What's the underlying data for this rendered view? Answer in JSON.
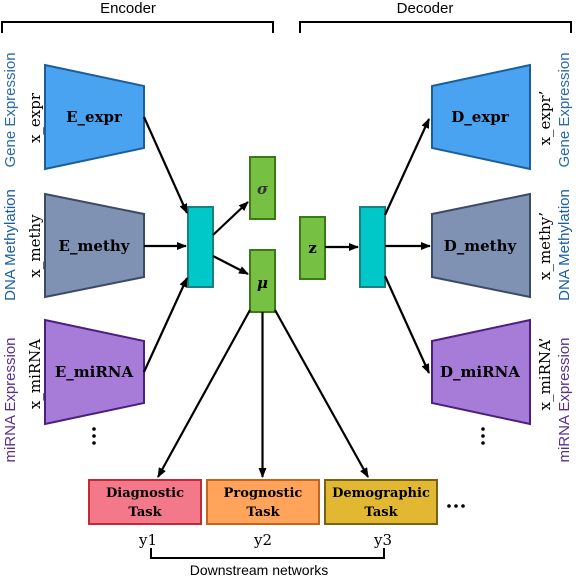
{
  "colors": {
    "expr_fill": "#4aa3f0",
    "expr_stroke": "#1a5f9a",
    "methy_fill": "#7f92b4",
    "methy_stroke": "#3c4a66",
    "mirna_fill": "#a77bd8",
    "mirna_stroke": "#4a1f7e",
    "latent_fill": "#76c043",
    "latent_stroke": "#3a7a16",
    "hidden_fill": "#00c8c8",
    "hidden_stroke": "#1a7f80",
    "diag_fill": "#f3788a",
    "diag_stroke": "#c42a35",
    "prog_fill": "#ffa45a",
    "prog_stroke": "#c6641c",
    "demo_fill": "#e2b832",
    "demo_stroke": "#7a6012",
    "label_gene": "#2a6aa8",
    "label_dna": "#1a5fa0",
    "label_mirna": "#5b2f8e"
  },
  "headers": {
    "encoder": "Encoder",
    "decoder": "Decoder",
    "downstream": "Downstream networks"
  },
  "side_labels": {
    "left": [
      "Gene Expression",
      "DNA Methylation",
      "miRNA Expression"
    ],
    "right": [
      "Gene Expression",
      "DNA Methylation",
      "miRNA Expression"
    ]
  },
  "inputs": [
    "x_expr",
    "x_methy",
    "x_miRNA"
  ],
  "outputs": [
    "x_expr’",
    "x_methy’",
    "x_miRNA’"
  ],
  "encoders": [
    "E_expr",
    "E_methy",
    "E_miRNA"
  ],
  "decoders": [
    "D_expr",
    "D_methy",
    "D_miRNA"
  ],
  "latent": {
    "sigma": "σ",
    "mu": "μ",
    "z": "z"
  },
  "tasks": [
    {
      "line1": "Diagnostic",
      "line2": "Task",
      "output": "y1"
    },
    {
      "line1": "Prognostic",
      "line2": "Task",
      "output": "y2"
    },
    {
      "line1": "Demographic",
      "line2": "Task",
      "output": "y3"
    }
  ],
  "ellipsis": "…"
}
